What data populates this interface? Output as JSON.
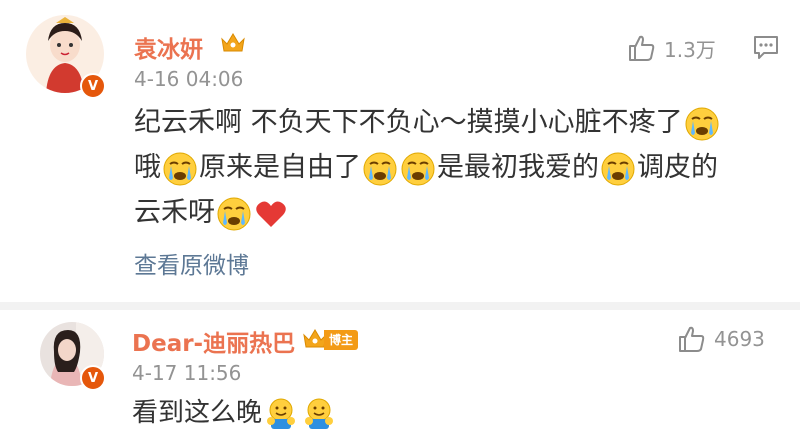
{
  "comments": [
    {
      "username": "袁冰妍",
      "time": "4-16 04:06",
      "likes": "1.3万",
      "text_parts": [
        "纪云禾啊 不负天下不负心～摸摸小心脏不疼了",
        "哦",
        "原来是自由了",
        "",
        "是最初我爱的",
        "调皮的",
        "云禾呀"
      ],
      "view_more": "查看原微博",
      "emojis": [
        "crying-face-emoji",
        "red-heart-emoji"
      ]
    },
    {
      "username": "Dear-迪丽热巴",
      "badge": "博主",
      "time": "4-17 11:56",
      "likes": "4693",
      "text": "看到这么晚",
      "emojis": [
        "hug-emoji"
      ]
    }
  ],
  "colors": {
    "username": "#eb7350",
    "time": "#939393",
    "link": "#5d7895",
    "separator": "#f2f2f2",
    "verified": "#e5570b",
    "crown": "#f3a51b",
    "heart": "#e53935"
  }
}
